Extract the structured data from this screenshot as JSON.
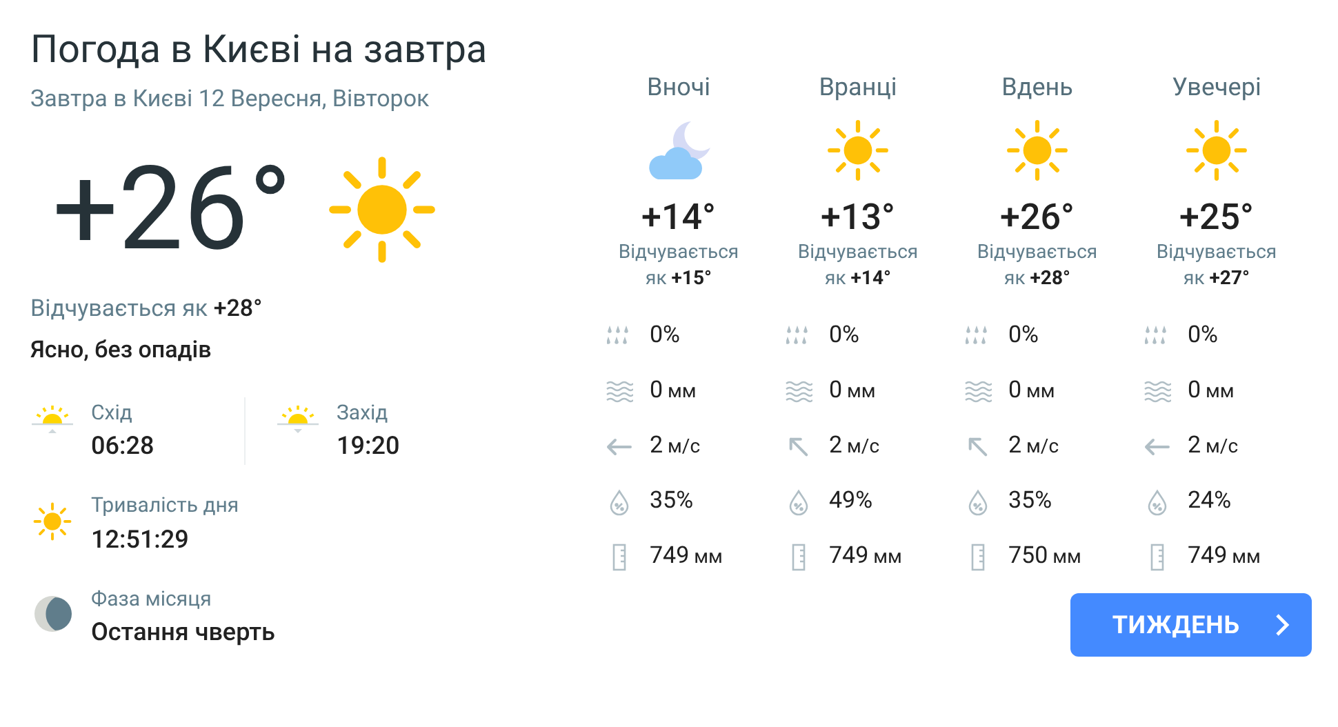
{
  "title": "Погода в Києві на завтра",
  "subtitle": "Завтра в Києві 12 Вересня, Вівторок",
  "current": {
    "kind": "sun",
    "temperature": "+26°",
    "feels_like": "Відчувається як **+28°**",
    "description": "Ясно, без опадів"
  },
  "sun": [
    {
      "kind": "sunrise",
      "label": "Схід",
      "time": "06:28"
    },
    {
      "kind": "sunset",
      "label": "Захід",
      "time": "19:20"
    }
  ],
  "day_length": {
    "label": "Тривалість дня",
    "value": "12:51:29"
  },
  "moon": {
    "label": "Фаза місяця",
    "value": "Остання чверть"
  },
  "periods": [
    {
      "kind": "night",
      "name": "Вночі",
      "temperature": "+14°",
      "feels_like": "Відчувається як **+15°**",
      "precip_chance": "0%",
      "precip": {
        "value": "0",
        "unit": "мм"
      },
      "wind": {
        "kind": "west",
        "value": "2",
        "unit": "м/с"
      },
      "humidity": "35%",
      "pressure": {
        "value": "749",
        "unit": "мм"
      }
    },
    {
      "kind": "sun",
      "name": "Вранці",
      "temperature": "+13°",
      "feels_like": "Відчувається як **+14°**",
      "precip_chance": "0%",
      "precip": {
        "value": "0",
        "unit": "мм"
      },
      "wind": {
        "kind": "northwest",
        "value": "2",
        "unit": "м/с"
      },
      "humidity": "49%",
      "pressure": {
        "value": "749",
        "unit": "мм"
      }
    },
    {
      "kind": "sun",
      "name": "Вдень",
      "temperature": "+26°",
      "feels_like": "Відчувається як **+28°**",
      "precip_chance": "0%",
      "precip": {
        "value": "0",
        "unit": "мм"
      },
      "wind": {
        "kind": "northwest",
        "value": "2",
        "unit": "м/с"
      },
      "humidity": "35%",
      "pressure": {
        "value": "750",
        "unit": "мм"
      }
    },
    {
      "kind": "sun",
      "name": "Увечері",
      "temperature": "+25°",
      "feels_like": "Відчувається як **+27°**",
      "precip_chance": "0%",
      "precip": {
        "value": "0",
        "unit": "мм"
      },
      "wind": {
        "kind": "west",
        "value": "2",
        "unit": "м/с"
      },
      "humidity": "24%",
      "pressure": {
        "value": "749",
        "unit": "мм"
      }
    }
  ],
  "week_button": {
    "label": "ТИЖДЕНЬ"
  }
}
